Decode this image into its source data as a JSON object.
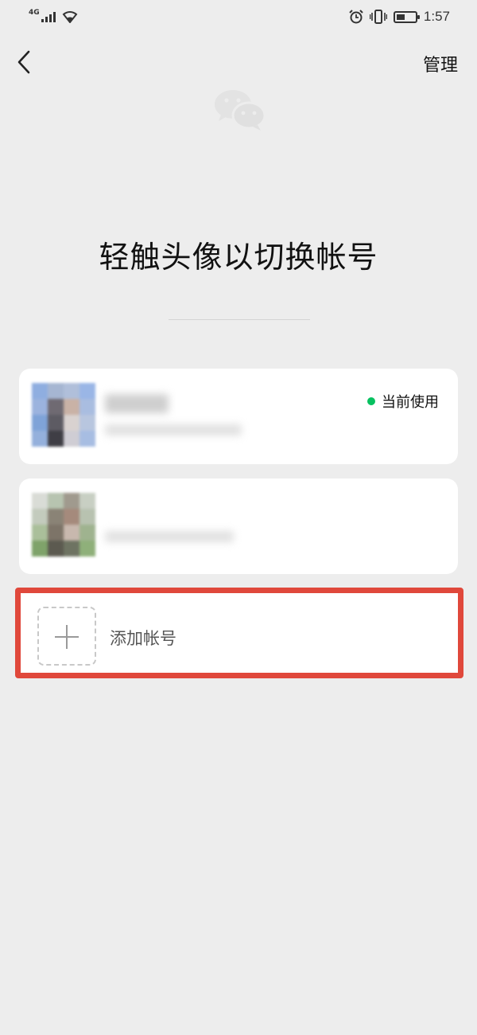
{
  "status_bar": {
    "network": "4G",
    "time": "1:57",
    "battery_level": 0.45,
    "icons": [
      "signal-icon",
      "wifi-icon",
      "alarm-icon",
      "vibrate-icon",
      "battery-icon"
    ]
  },
  "nav": {
    "back_icon": "chevron-left-icon",
    "manage_label": "管理"
  },
  "logo_icon": "wechat-logo-icon",
  "title": "轻触头像以切换帐号",
  "accounts": [
    {
      "current_label": "当前使用",
      "status_color": "#07c160",
      "is_current": true
    },
    {
      "is_current": false
    }
  ],
  "add_account": {
    "label": "添加帐号",
    "icon": "plus-icon",
    "highlight_color": "#e0483b"
  }
}
